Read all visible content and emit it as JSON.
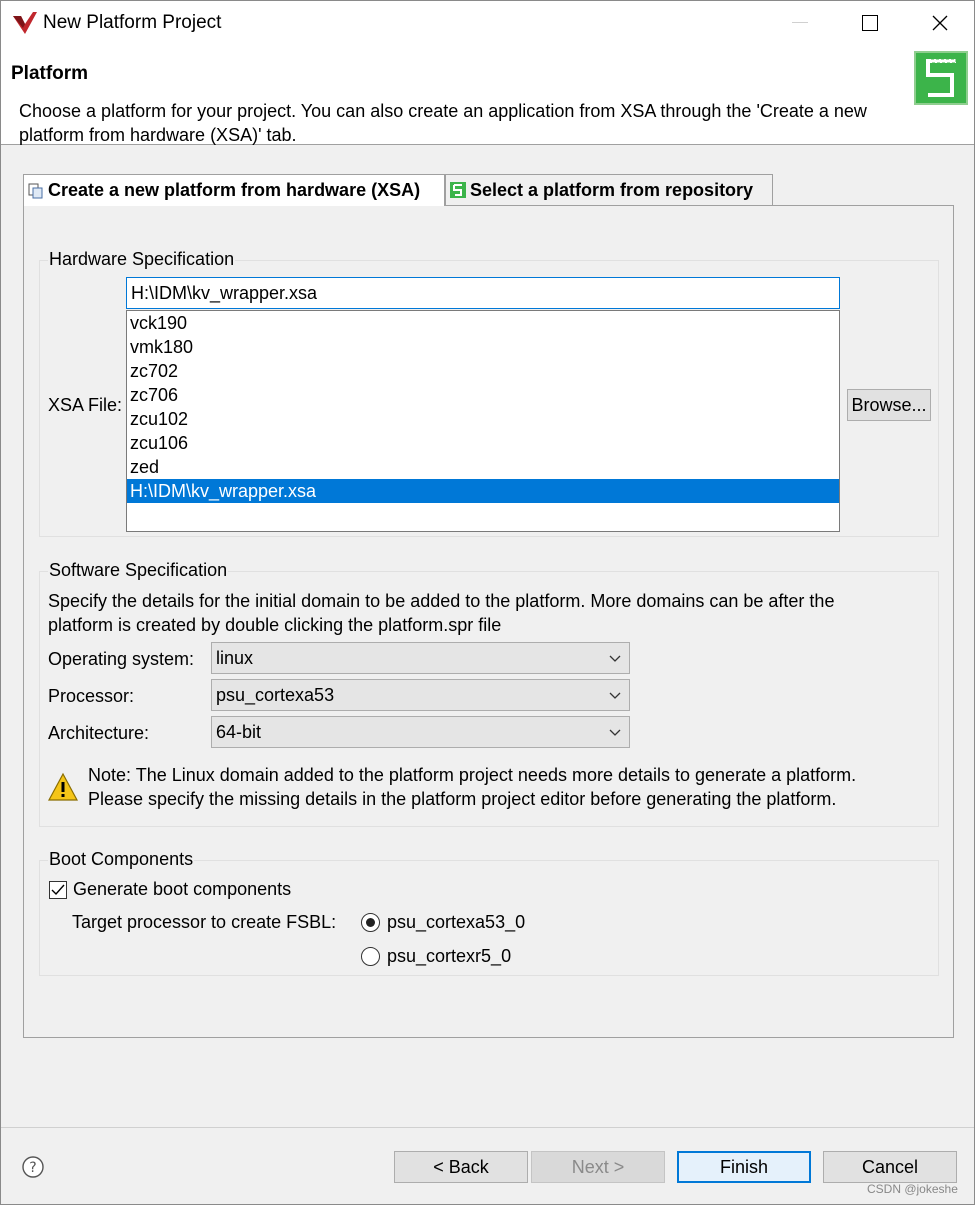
{
  "window": {
    "title": "New Platform Project"
  },
  "header": {
    "title": "Platform",
    "description": "Choose a platform for your project. You can also create an application from XSA through the 'Create a new platform from hardware (XSA)' tab."
  },
  "tabs": [
    {
      "label": "Create a new platform from hardware (XSA)",
      "active": true
    },
    {
      "label": "Select a platform from repository",
      "active": false
    }
  ],
  "hardware": {
    "group_label": "Hardware Specification",
    "xsa_label": "XSA File:",
    "xsa_value": "H:\\IDM\\kv_wrapper.xsa",
    "options": [
      "vck190",
      "vmk180",
      "zc702",
      "zc706",
      "zcu102",
      "zcu106",
      "zed",
      "H:\\IDM\\kv_wrapper.xsa"
    ],
    "selected_index": 7,
    "browse_label": "Browse..."
  },
  "software": {
    "group_label": "Software Specification",
    "description_line1": "Specify the details for the initial domain to be added to the platform. More domains can be after the",
    "description_line2": "platform is created by double clicking the platform.spr file",
    "os_label": "Operating system:",
    "os_value": "linux",
    "processor_label": "Processor:",
    "processor_value": "psu_cortexa53",
    "arch_label": "Architecture:",
    "arch_value": "64-bit",
    "note_line1": "Note: The Linux domain added to the platform project needs more details to generate a platform.",
    "note_line2": "Please specify the missing details in the platform project editor before generating the platform."
  },
  "boot": {
    "group_label": "Boot Components",
    "generate_label": "Generate boot components",
    "generate_checked": true,
    "target_label": "Target processor to create FSBL:",
    "option_a53": "psu_cortexa53_0",
    "option_r5": "psu_cortexr5_0",
    "selected": "psu_cortexa53_0"
  },
  "footer": {
    "back_label": "< Back",
    "next_label": "Next >",
    "finish_label": "Finish",
    "cancel_label": "Cancel"
  },
  "watermark": "CSDN @jokeshe",
  "colors": {
    "accent": "#0078d7",
    "banner_green": "#3cb44a"
  },
  "icons": {
    "app": "vitis-logo-icon",
    "banner": "platform-banner-icon",
    "warning": "warning-triangle-icon",
    "help": "help-icon"
  }
}
